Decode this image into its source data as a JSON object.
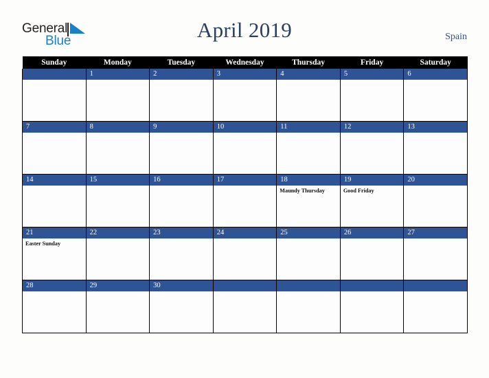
{
  "brand": {
    "name_top": "General",
    "name_bottom": "Blue",
    "mark": "triangle-icon",
    "color_top": "#231f20",
    "color_bottom": "#1b7fc4"
  },
  "header": {
    "title": "April 2019",
    "country": "Spain",
    "title_color": "#2b3f63"
  },
  "calendar": {
    "month": "April",
    "year": "2019",
    "weekday_headers": [
      "Sunday",
      "Monday",
      "Tuesday",
      "Wednesday",
      "Thursday",
      "Friday",
      "Saturday"
    ],
    "header_bg": "#000000",
    "daynum_bg": "#2f5496",
    "cell_bg": "#fdfdfd",
    "weeks": [
      [
        {
          "day": "",
          "events": []
        },
        {
          "day": "1",
          "events": []
        },
        {
          "day": "2",
          "events": []
        },
        {
          "day": "3",
          "events": []
        },
        {
          "day": "4",
          "events": []
        },
        {
          "day": "5",
          "events": []
        },
        {
          "day": "6",
          "events": []
        }
      ],
      [
        {
          "day": "7",
          "events": []
        },
        {
          "day": "8",
          "events": []
        },
        {
          "day": "9",
          "events": []
        },
        {
          "day": "10",
          "events": []
        },
        {
          "day": "11",
          "events": []
        },
        {
          "day": "12",
          "events": []
        },
        {
          "day": "13",
          "events": []
        }
      ],
      [
        {
          "day": "14",
          "events": []
        },
        {
          "day": "15",
          "events": []
        },
        {
          "day": "16",
          "events": []
        },
        {
          "day": "17",
          "events": []
        },
        {
          "day": "18",
          "events": [
            "Maundy Thursday"
          ]
        },
        {
          "day": "19",
          "events": [
            "Good Friday"
          ]
        },
        {
          "day": "20",
          "events": []
        }
      ],
      [
        {
          "day": "21",
          "events": [
            "Easter Sunday"
          ]
        },
        {
          "day": "22",
          "events": []
        },
        {
          "day": "23",
          "events": []
        },
        {
          "day": "24",
          "events": []
        },
        {
          "day": "25",
          "events": []
        },
        {
          "day": "26",
          "events": []
        },
        {
          "day": "27",
          "events": []
        }
      ],
      [
        {
          "day": "28",
          "events": []
        },
        {
          "day": "29",
          "events": []
        },
        {
          "day": "30",
          "events": []
        },
        {
          "day": "",
          "events": []
        },
        {
          "day": "",
          "events": []
        },
        {
          "day": "",
          "events": []
        },
        {
          "day": "",
          "events": []
        }
      ]
    ]
  }
}
